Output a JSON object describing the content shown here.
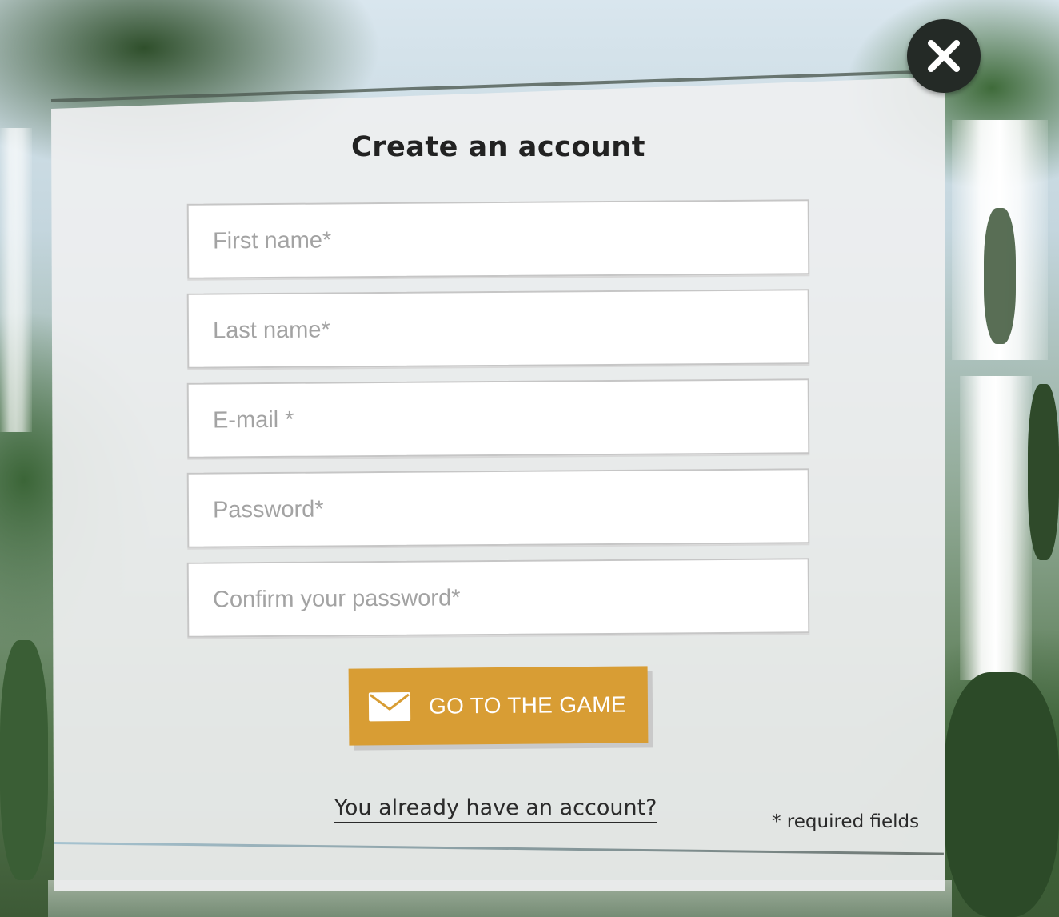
{
  "dialog": {
    "title": "Create an account",
    "close_icon": "close-icon"
  },
  "form": {
    "first_name": {
      "placeholder": "First name*",
      "value": ""
    },
    "last_name": {
      "placeholder": "Last name*",
      "value": ""
    },
    "email": {
      "placeholder": "E-mail *",
      "value": ""
    },
    "password": {
      "placeholder": "Password*",
      "value": ""
    },
    "confirm_password": {
      "placeholder": "Confirm your password*",
      "value": ""
    }
  },
  "submit": {
    "label": "GO TO THE GAME",
    "icon": "mail-icon"
  },
  "footer": {
    "login_link": "You already have an account?",
    "required_note": "* required fields"
  },
  "colors": {
    "accent": "#d89d34",
    "panel": "#eeeff0",
    "close_bg": "#242a26",
    "text": "#222222"
  }
}
